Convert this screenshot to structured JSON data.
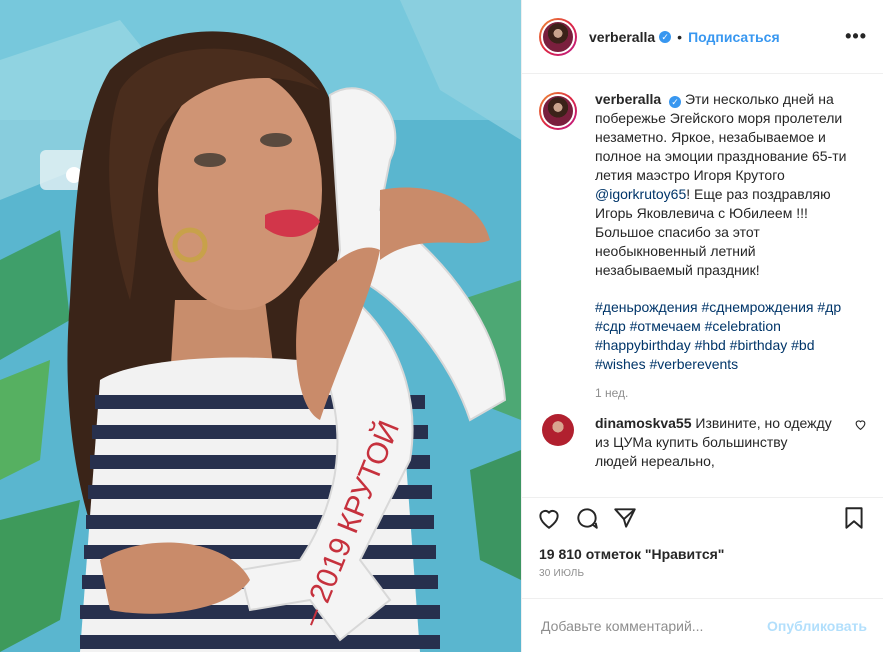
{
  "header": {
    "username": "verberalla",
    "separator": "•",
    "follow_label": "Подписаться",
    "more_label": "•••"
  },
  "photo": {
    "wheel_text": "– 2019 КРУТОЙ"
  },
  "caption": {
    "username": "verberalla",
    "text_before_mention": "Эти несколько дней на побережье Эгейского моря пролетели незаметно. Яркое, незабываемое и полное на эмоции празднование 65-ти летия маэстро Игоря Крутого ",
    "mention": "@igorkrutoy65",
    "text_after_mention": "! Еще раз поздравляю Игорь Яковлевича с Юбилеем !!!Большое спасибо за этот необыкновенный летний незабываемый праздник!",
    "hashtags": "#деньрождения #сднемрождения #др #сдр #отмечаем #celebration #happybirthday #hbd #birthday #bd #wishes #verberevents",
    "time_ago": "1 нед."
  },
  "comment": {
    "username": "dinamoskva55",
    "text": "Извините, но одежду из ЦУМа купить большинству людей нереально,"
  },
  "actions": {
    "likes": "19 810 отметок \"Нравится\"",
    "date": "30 ИЮЛЬ"
  },
  "add_comment": {
    "placeholder": "Добавьте комментарий...",
    "publish_label": "Опубликовать"
  },
  "colors": {
    "accent": "#3897f0",
    "link": "#003569",
    "muted": "#8e8e8e",
    "publish_disabled": "#b2dffc"
  }
}
